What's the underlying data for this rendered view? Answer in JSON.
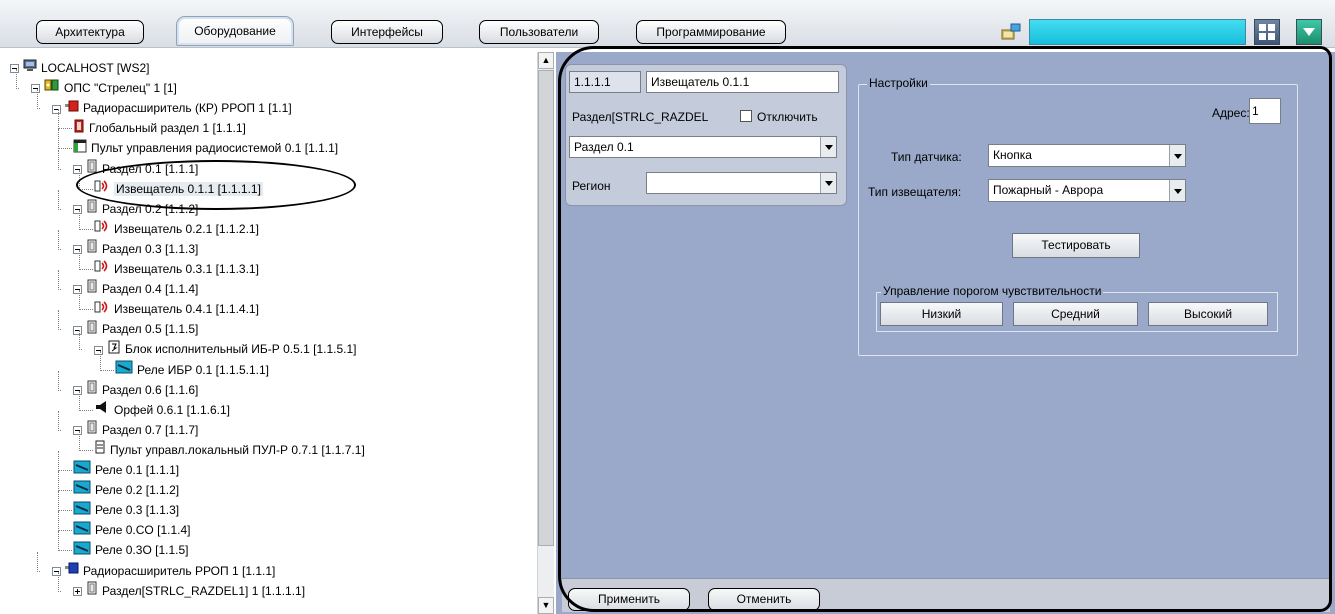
{
  "toolbar": {
    "tabs": [
      "Архитектура",
      "Оборудование",
      "Интерфейсы",
      "Пользователи",
      "Программирование"
    ],
    "active_tab": "Оборудование"
  },
  "tree": [
    {
      "label": "LOCALHOST [WS2]",
      "icon": "computer-icon",
      "level": 0,
      "expander": "minus"
    },
    {
      "label": "ОПС \"Стрелец\" 1 [1]",
      "icon": "ops-icon",
      "level": 1,
      "expander": "minus"
    },
    {
      "label": "Радиорасширитель (КР) РРОП 1 [1.1]",
      "icon": "expander-red-icon",
      "level": 2,
      "expander": "minus"
    },
    {
      "label": "Глобальный раздел 1 [1.1.1]",
      "icon": "global-section-icon",
      "level": 3
    },
    {
      "label": "Пульт управления радиосистемой 0.1 [1.1.1]",
      "icon": "panel-icon",
      "level": 3
    },
    {
      "label": "Раздел 0.1 [1.1.1]",
      "icon": "section-icon",
      "level": 3,
      "expander": "minus"
    },
    {
      "label": "Извещатель 0.1.1 [1.1.1.1]",
      "icon": "detector-icon",
      "level": 4,
      "selected": true
    },
    {
      "label": "Раздел 0.2 [1.1.2]",
      "icon": "section-icon",
      "level": 3,
      "expander": "minus"
    },
    {
      "label": "Извещатель 0.2.1 [1.1.2.1]",
      "icon": "detector-icon",
      "level": 4
    },
    {
      "label": "Раздел 0.3 [1.1.3]",
      "icon": "section-icon",
      "level": 3,
      "expander": "minus"
    },
    {
      "label": "Извещатель 0.3.1 [1.1.3.1]",
      "icon": "detector-icon",
      "level": 4
    },
    {
      "label": "Раздел 0.4 [1.1.4]",
      "icon": "section-icon",
      "level": 3,
      "expander": "minus"
    },
    {
      "label": "Извещатель 0.4.1 [1.1.4.1]",
      "icon": "detector-icon",
      "level": 4
    },
    {
      "label": "Раздел 0.5 [1.1.5]",
      "icon": "section-icon",
      "level": 3,
      "expander": "minus"
    },
    {
      "label": "Блок исполнительный ИБ-Р 0.5.1 [1.1.5.1]",
      "icon": "actuator-block-icon",
      "level": 4,
      "expander": "minus"
    },
    {
      "label": "Реле ИБР 0.1 [1.1.5.1.1]",
      "icon": "relay-icon",
      "level": 5
    },
    {
      "label": "Раздел 0.6 [1.1.6]",
      "icon": "section-icon",
      "level": 3,
      "expander": "minus"
    },
    {
      "label": "Орфей 0.6.1 [1.1.6.1]",
      "icon": "siren-icon",
      "level": 4
    },
    {
      "label": "Раздел 0.7 [1.1.7]",
      "icon": "section-icon",
      "level": 3,
      "expander": "minus"
    },
    {
      "label": "Пульт управл.локальный ПУЛ-Р 0.7.1 [1.1.7.1]",
      "icon": "local-panel-icon",
      "level": 4
    },
    {
      "label": "Реле 0.1 [1.1.1]",
      "icon": "relay-icon",
      "level": 3
    },
    {
      "label": "Реле 0.2 [1.1.2]",
      "icon": "relay-icon",
      "level": 3
    },
    {
      "label": "Реле 0.3 [1.1.3]",
      "icon": "relay-icon",
      "level": 3
    },
    {
      "label": "Реле 0.CO [1.1.4]",
      "icon": "relay-icon",
      "level": 3
    },
    {
      "label": "Реле 0.3O [1.1.5]",
      "icon": "relay-icon",
      "level": 3
    },
    {
      "label": "Радиорасширитель РРОП 1 [1.1.1]",
      "icon": "expander-blue-icon",
      "level": 2,
      "expander": "minus"
    },
    {
      "label": "Раздел[STRLC_RAZDEL1] 1 [1.1.1.1]",
      "icon": "section-icon",
      "level": 3,
      "expander": "plus"
    }
  ],
  "card": {
    "id_value": "1.1.1.1",
    "name_value": "Извещатель 0.1.1",
    "section_label": "Раздел[STRLC_RAZDEL",
    "disable_label": "Отключить",
    "section_value": "Раздел 0.1",
    "region_label": "Регион",
    "region_value": ""
  },
  "settings": {
    "legend": "Настройки",
    "address_label": "Адрес:",
    "address_value": "1",
    "sensor_type_label": "Тип датчика:",
    "sensor_type_value": "Кнопка",
    "detector_type_label": "Тип извещателя:",
    "detector_type_value": "Пожарный - Аврора",
    "test_button": "Тестировать",
    "sensitivity_legend": "Управление порогом чувствительности",
    "low_button": "Низкий",
    "medium_button": "Средний",
    "high_button": "Высокий"
  },
  "footer": {
    "apply_button": "Применить",
    "cancel_button": "Отменить"
  },
  "colors": {
    "panel_bg": "#9aa9c9",
    "card_bg": "#c4cbdb",
    "search_bg": "#1fc5e0"
  }
}
